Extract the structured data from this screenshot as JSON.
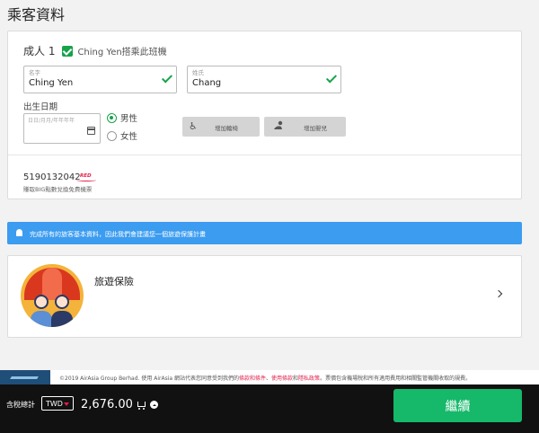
{
  "page": {
    "title": "乘客資料"
  },
  "passenger": {
    "label": "成人 1",
    "checkbox_label": "Ching Yen搭乘此班機",
    "first_name": {
      "label": "名字",
      "value": "Ching Yen"
    },
    "last_name": {
      "label": "姓氏",
      "value": "Chang"
    },
    "dob": {
      "label": "出生日期",
      "placeholder": "日日/月月/年年年年"
    },
    "gender": {
      "male": "男性",
      "female": "女性",
      "selected": "male"
    },
    "add_wheelchair": "增加輪椅",
    "add_infant": "增加嬰兒",
    "member_id": "5190132042",
    "member_badge": "RED",
    "member_note": "賺取BIG點數兌換免費機票"
  },
  "banner": {
    "text": "完成所有的旅客基本資料，因此我們會建議您一個旅遊保護計畫"
  },
  "insurance": {
    "title": "旅遊保險"
  },
  "footer": {
    "copyright": "©2019 AirAsia Group Berhad. 使用 AirAsia 網站代表您同意受到我們的",
    "link1": "條款和條件",
    "sep1": "、",
    "link2": "使用條款",
    "sep2": "和",
    "link3": "隱私政策",
    "rest": "。票價包含機場稅和所有適用費用和相關監管機關收取的規費。"
  },
  "bottom_bar": {
    "total_label": "含稅總計",
    "currency": "TWD",
    "amount": "2,676.00",
    "continue_label": "繼續"
  },
  "colors": {
    "accent_green": "#16b86a",
    "banner_blue": "#3b9cf0",
    "brand_red": "#e11d48"
  }
}
